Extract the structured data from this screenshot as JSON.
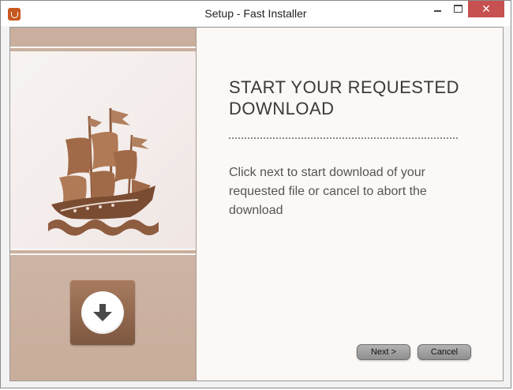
{
  "window": {
    "title": "Setup - Fast Installer",
    "app_icon": "installer-shield-icon",
    "controls": {
      "minimize_icon": "minimize-icon",
      "maximize_icon": "maximize-icon",
      "close_icon": "close-icon",
      "close_glyph": "✕"
    }
  },
  "sidebar": {
    "logo_icon": "pirate-ship-icon",
    "download_icon": "download-arrow-icon"
  },
  "main": {
    "heading": "START YOUR REQUESTED DOWNLOAD",
    "description": "Click next to start download of your requested file or cancel to abort the download"
  },
  "buttons": {
    "next_label": "Next >",
    "cancel_label": "Cancel"
  },
  "colors": {
    "accent": "#c8581f",
    "close_button": "#c75050",
    "sidebar_band": "#caaf9e",
    "ship_brown": "#a06a48",
    "tile_brown": "#7d5740"
  }
}
